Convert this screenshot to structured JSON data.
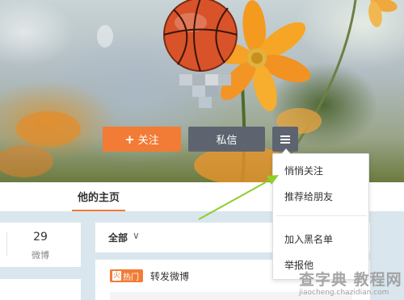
{
  "actions": {
    "follow_plus": "+",
    "follow_label": "关注",
    "message_label": "私信"
  },
  "tabs": {
    "home_label": "他的主页"
  },
  "stats": {
    "count": "29",
    "count_label": "微博"
  },
  "feed": {
    "filter_label": "全部",
    "filter_chevron": "∨",
    "hot_badge": "热门",
    "hot_icon": "火",
    "item_title": "转发微博"
  },
  "dropdown": {
    "items": [
      "悄悄关注",
      "推荐给朋友",
      "加入黑名单",
      "举报他"
    ]
  },
  "watermark": {
    "main": "查字典 教程网",
    "url": "jiaocheng.chazidian.com"
  },
  "colors": {
    "accent": "#f27b35",
    "dark_button": "#5d6470",
    "arrow": "#8fce2a"
  },
  "icons": [
    "basketball-icon",
    "hamburger-icon",
    "fire-icon",
    "chevron-down-icon"
  ]
}
